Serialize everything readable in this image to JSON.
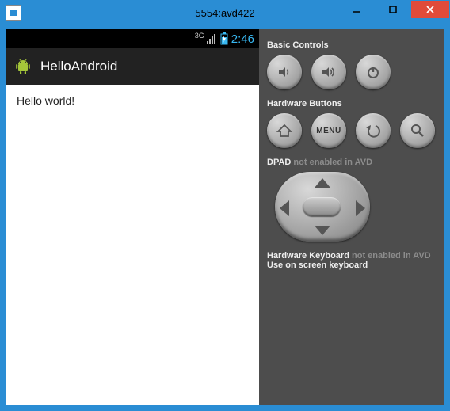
{
  "window": {
    "title": "5554:avd422"
  },
  "device": {
    "statusbar": {
      "network_label": "3G",
      "clock": "2:46"
    },
    "appbar": {
      "title": "HelloAndroid"
    },
    "content": {
      "text": "Hello world!"
    }
  },
  "panel": {
    "basic_controls_label": "Basic Controls",
    "hardware_buttons_label": "Hardware Buttons",
    "menu_button_label": "MENU",
    "dpad_label": "DPAD",
    "dpad_disabled_note": "not enabled in AVD",
    "hw_keyboard_label": "Hardware Keyboard",
    "hw_keyboard_disabled_note": "not enabled in AVD",
    "hw_keyboard_hint": "Use on screen keyboard"
  }
}
